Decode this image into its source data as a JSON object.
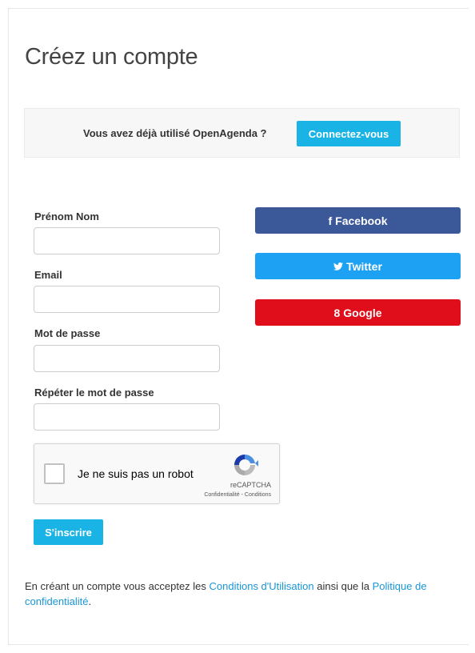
{
  "page": {
    "title": "Créez un compte"
  },
  "login_bar": {
    "text": "Vous avez déjà utilisé OpenAgenda ?",
    "button_label": "Connectez-vous"
  },
  "form": {
    "name_label": "Prénom Nom",
    "email_label": "Email",
    "password_label": "Mot de passe",
    "password_repeat_label": "Répéter le mot de passe",
    "submit_label": "S'inscrire"
  },
  "social": {
    "facebook": {
      "icon": "f",
      "label": "Facebook"
    },
    "twitter": {
      "label": "Twitter"
    },
    "google": {
      "icon": "8",
      "label": "Google"
    }
  },
  "captcha": {
    "label": "Je ne suis pas un robot",
    "brand": "reCAPTCHA",
    "terms": "Confidentialité - Conditions"
  },
  "terms": {
    "prefix": "En créant un compte vous acceptez les ",
    "link1": "Conditions d'Utilisation",
    "middle": " ainsi que la ",
    "link2": "Politique de confidentialité",
    "suffix": "."
  },
  "colors": {
    "primary": "#1ab3e6",
    "facebook": "#3b5998",
    "twitter": "#1da1f2",
    "google": "#e00d1a",
    "link": "#1a96d6"
  }
}
